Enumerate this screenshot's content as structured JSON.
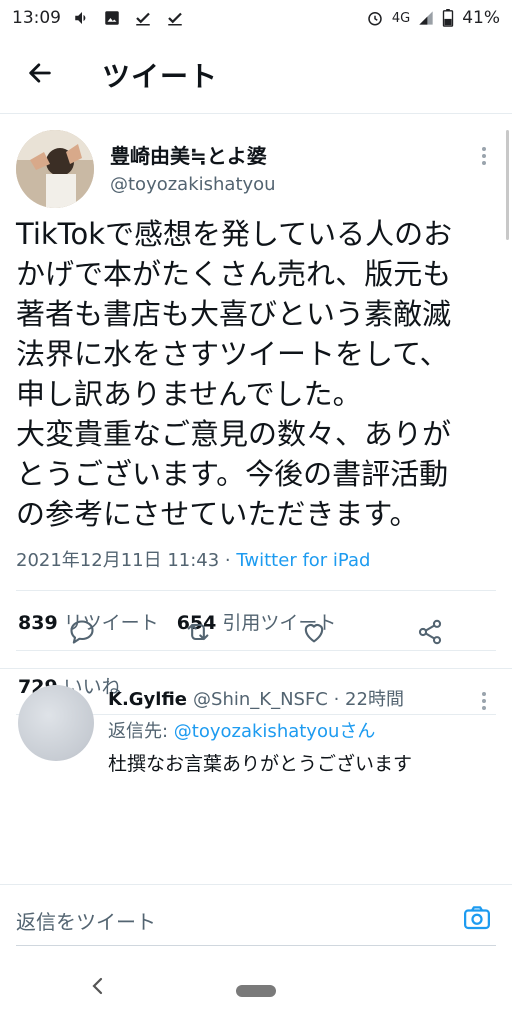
{
  "status": {
    "time": "13:09",
    "network": "4G",
    "battery": "41%"
  },
  "header": {
    "title": "ツイート"
  },
  "tweet": {
    "author_name": "豊崎由美≒とよ婆",
    "author_handle": "@toyozakishatyou",
    "body": "TikTokで感想を発している人のお\nかげで本がたくさん売れ、版元も\n著者も書店も大喜びという素敵滅\n法界に水をさすツイートをして、\n申し訳ありませんでした。\n大変貴重なご意見の数々、ありが\nとうございます。今後の書評活動\nの参考にさせていただきます。",
    "timestamp": "2021年12月11日 11:43 · ",
    "source": "Twitter for iPad",
    "retweets_count": "839",
    "retweets_label": "リツイート",
    "quotes_count": "654",
    "quotes_label": "引用ツイート",
    "likes_count": "729",
    "likes_label": "いいね"
  },
  "reply": {
    "name": "K.Gylfie",
    "handle": "@Shin_K_NSFC",
    "time": "· 22時間",
    "reply_prefix": "返信先: ",
    "reply_mention": "@toyozakishatyouさん",
    "text": "杜撰なお言葉ありがとうございます"
  },
  "composer": {
    "placeholder": "返信をツイート"
  },
  "colors": {
    "accent": "#1d9bf0",
    "secondary_text": "#536471",
    "text": "#0f1419"
  },
  "icons": [
    "back-arrow-icon",
    "more-icon",
    "reply-icon",
    "retweet-icon",
    "like-icon",
    "share-icon",
    "camera-icon",
    "nav-back-icon"
  ]
}
